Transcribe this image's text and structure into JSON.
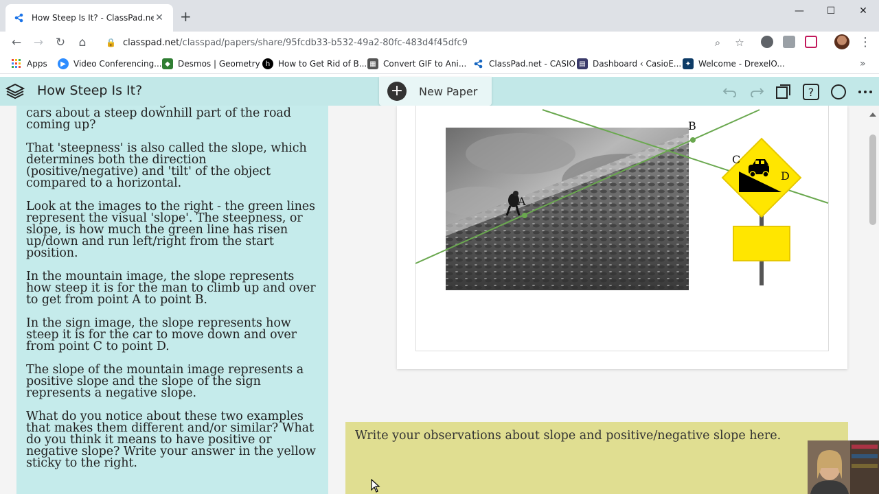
{
  "browser": {
    "tab_title": "How Steep Is It? - ClassPad.net",
    "address": {
      "host": "classpad.net",
      "path": "/classpad/papers/share/95fcdb33-b532-49a2-80fc-483d4f45dfc9"
    },
    "bookmarks": [
      {
        "label": "Apps",
        "icon": "apps-grid-icon",
        "color": "#4285f4"
      },
      {
        "label": "Video Conferencing...",
        "icon": "video-icon",
        "color": "#2d8cff"
      },
      {
        "label": "Desmos | Geometry",
        "icon": "desmos-icon",
        "color": "#2f7d32"
      },
      {
        "label": "How to Get Rid of B...",
        "icon": "bookmark-icon",
        "color": "#000000"
      },
      {
        "label": "Convert GIF to Ani...",
        "icon": "convert-icon",
        "color": "#555555"
      },
      {
        "label": "ClassPad.net - CASIO",
        "icon": "classpad-icon",
        "color": "#1565c0"
      },
      {
        "label": "Dashboard ‹ CasioE...",
        "icon": "dashboard-icon",
        "color": "#3a3a6a"
      },
      {
        "label": "Welcome - DrexelO...",
        "icon": "drexel-icon",
        "color": "#0d3b66"
      }
    ]
  },
  "app": {
    "doc_title": "How Steep Is It?",
    "new_paper_label": "New Paper",
    "accent": "#c2e8e8"
  },
  "text_paper": {
    "paragraphs": [
      "Or ever seen a road sign that warns trucks and cars about a steep downhill part of the road coming up?",
      "That 'steepness' is also called the slope, which determines both the direction (positive/negative) and 'tilt' of the object compared to a horizontal.",
      "Look at the images to the right - the green lines represent the visual 'slope'. The steepness, or slope, is how much the green line has risen up/down and run left/right from the start position.",
      "In the mountain image, the slope represents how steep it is for the man to climb up and over to get from point A to point B.",
      "In the sign image, the slope represents how steep it is for the car to move down and over from point C to point D.",
      "The slope of the mountain image represents a positive slope and the slope of the sign represents a negative slope.",
      "What do you notice about these two examples that makes them different and/or similar? What do you think it means to have positive or negative slope? Write your answer in the yellow sticky to the right."
    ]
  },
  "image_paper": {
    "point_labels": [
      "A",
      "B",
      "C",
      "D"
    ],
    "line_color": "#6aa84f"
  },
  "sticky": {
    "text": "Write your observations about slope and positive/negative slope here.",
    "color": "#e0de91"
  }
}
